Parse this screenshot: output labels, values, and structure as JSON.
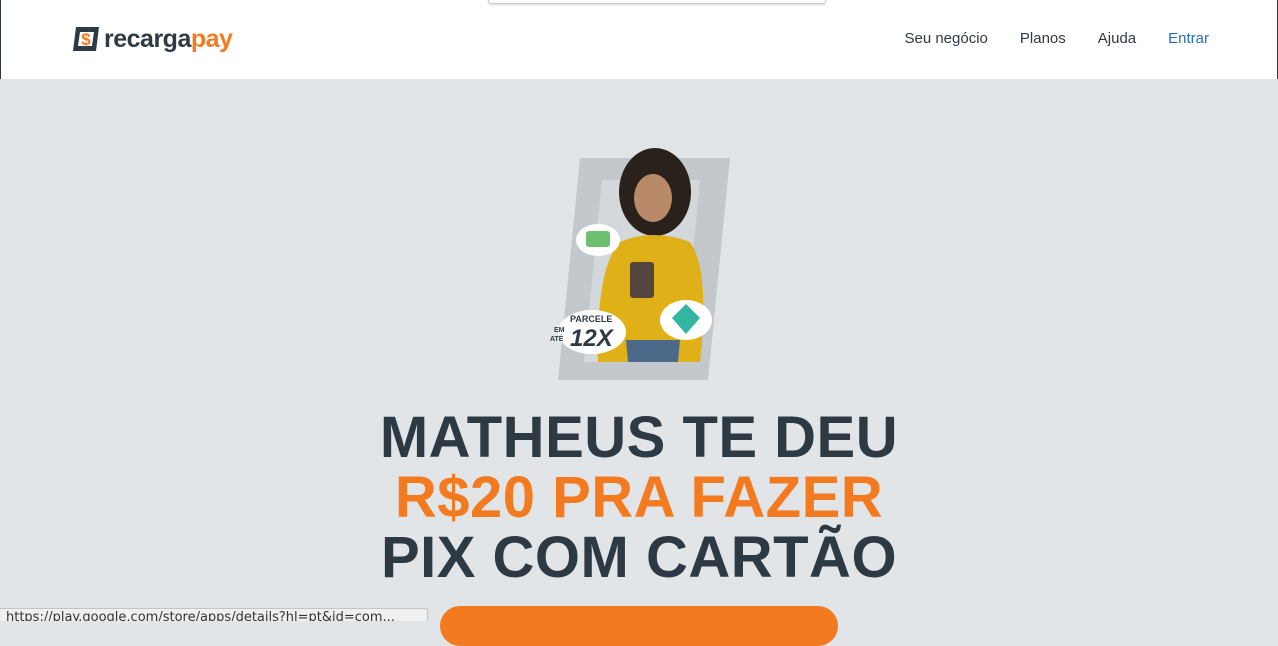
{
  "brand": {
    "name_part1": "recarga",
    "name_part2": "pay",
    "color_dark": "#2e3a43",
    "color_accent": "#f47a20"
  },
  "nav": {
    "items": [
      "Seu negócio",
      "Planos",
      "Ajuda"
    ],
    "login": "Entrar"
  },
  "hero": {
    "badge_line1": "PARCELE",
    "badge_line2": "EM",
    "badge_line3": "ATÉ",
    "badge_value": "12X",
    "headline_line1": "MATHEUS TE DEU",
    "headline_line2": "R$20 PRA FAZER",
    "headline_line3": "PIX COM CARTÃO"
  },
  "status": {
    "url": "https://play.google.com/store/apps/details?hl=pt&id=com..."
  }
}
